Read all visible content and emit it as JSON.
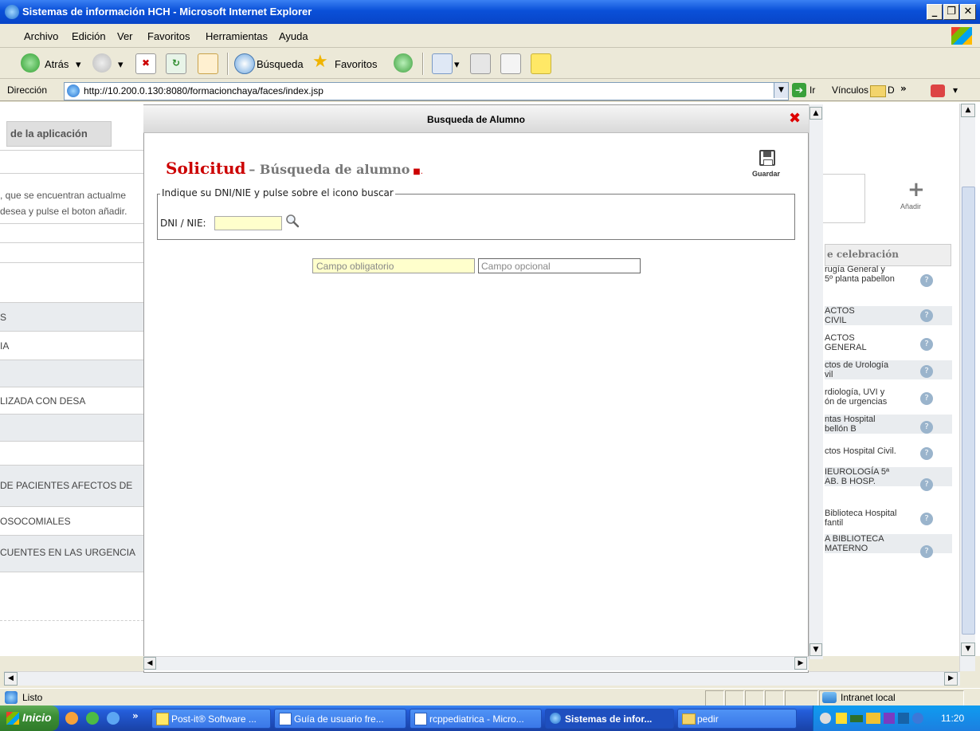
{
  "window": {
    "title": "Sistemas de información HCH - Microsoft Internet Explorer"
  },
  "menu": [
    "Archivo",
    "Edición",
    "Ver",
    "Favoritos",
    "Herramientas",
    "Ayuda"
  ],
  "toolbar": {
    "back": "Atrás",
    "search": "Búsqueda",
    "favorites": "Favoritos"
  },
  "address": {
    "label": "Dirección",
    "url": "http://10.200.0.130:8080/formacionchaya/faces/index.jsp",
    "go": "Ir",
    "links": "Vínculos",
    "links_folder": "D"
  },
  "background_left": {
    "tab": "de la aplicación",
    "info_line1": ", que se encuentran actualme",
    "info_line2": "desea y pulse el boton añadir.",
    "rows": [
      "S",
      "IA",
      "LIZADA CON DESA",
      "DE PACIENTES AFECTOS DE",
      "OSOCOMIALES",
      "CUENTES EN LAS URGENCIA"
    ]
  },
  "background_right": {
    "add_label": "Añadir",
    "column_header": "e celebración",
    "rows": [
      [
        "rugía General y",
        "5º planta pabellon"
      ],
      [
        "ACTOS",
        "CIVIL"
      ],
      [
        "ACTOS",
        "GENERAL"
      ],
      [
        "ctos de Urología",
        "vil"
      ],
      [
        "rdiología, UVI y",
        "ón de urgencias"
      ],
      [
        "ntas Hospital",
        "bellón B"
      ],
      [
        "ctos Hospital Civil.",
        ""
      ],
      [
        "IEUROLOGÍA 5ª",
        "AB. B HOSP."
      ],
      [
        "Biblioteca Hospital",
        "fantil"
      ],
      [
        "A BIBLIOTECA",
        "MATERNO"
      ]
    ]
  },
  "modal": {
    "title": "Busqueda de Alumno",
    "heading_main": "Solicitud",
    "heading_sub": "– Búsqueda de alumno",
    "save_label": "Guardar",
    "fieldset_legend": "Indique su DNI/NIE y pulse sobre el icono buscar",
    "dni_label": "DNI / NIE:",
    "dni_value": "",
    "legend_required": "Campo obligatorio",
    "legend_optional": "Campo opcional"
  },
  "status": {
    "text": "Listo",
    "zone": "Intranet local"
  },
  "taskbar": {
    "start": "Inicio",
    "tasks": [
      "Post-it® Software ...",
      "Guía de usuario fre...",
      "rcppediatrica - Micro...",
      "Sistemas de infor...",
      "pedir"
    ],
    "clock": "11:20"
  },
  "colors": {
    "accent_red": "#cc0000",
    "required_bg": "#ffffcc",
    "xp_blue": "#245edb"
  }
}
